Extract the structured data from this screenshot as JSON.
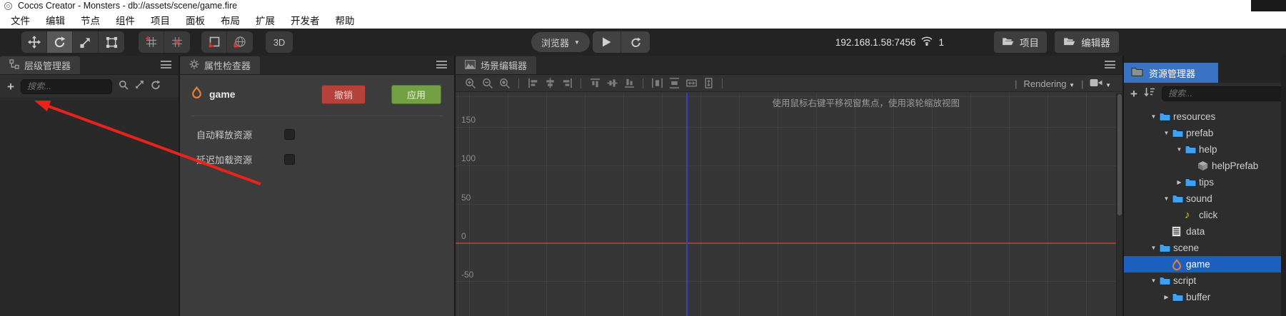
{
  "window": {
    "title": "Cocos Creator - Monsters - db://assets/scene/game.fire",
    "menus": [
      "文件",
      "编辑",
      "节点",
      "组件",
      "项目",
      "面板",
      "布局",
      "扩展",
      "开发者",
      "帮助"
    ]
  },
  "toolbar": {
    "transform_tools": [
      {
        "name": "move-tool",
        "icon": "move",
        "active": false
      },
      {
        "name": "rotate-tool",
        "icon": "rotate",
        "active": true
      },
      {
        "name": "scale-tool",
        "icon": "scale",
        "active": false
      },
      {
        "name": "rect-tool",
        "icon": "rect",
        "active": false
      }
    ],
    "gizmo_group_1": [
      {
        "name": "gizmo-position-button",
        "icon": "grid-red-corner"
      },
      {
        "name": "gizmo-anchor-button",
        "icon": "grid-red-center"
      }
    ],
    "gizmo_group_2": [
      {
        "name": "gizmo-local-button",
        "icon": "anchor-corner"
      },
      {
        "name": "gizmo-global-button",
        "icon": "anchor-globe"
      }
    ],
    "mode_label": "3D",
    "preview_target": "浏览器",
    "address": "192.168.1.58:7456",
    "device_count": "1",
    "project_button": "项目",
    "editor_button": "编辑器"
  },
  "hierarchy": {
    "title": "层级管理器",
    "search_placeholder": "搜索..."
  },
  "inspector": {
    "title": "属性检查器",
    "node_name": "game",
    "revert_button": "撤销",
    "apply_button": "应用",
    "properties": [
      {
        "label": "自动释放资源",
        "checked": false
      },
      {
        "label": "延迟加载资源",
        "checked": false
      }
    ]
  },
  "scene": {
    "title": "场景编辑器",
    "toolbar_icons": [
      "zoom-in-icon",
      "zoom-out-icon",
      "zoom-reset-icon",
      "sep",
      "align-left-edge-icon",
      "align-h-center-icon",
      "align-right-edge-icon",
      "sep",
      "align-top-edge-icon",
      "align-v-center-icon",
      "align-bottom-edge-icon",
      "sep",
      "distribute-h-icon",
      "distribute-v-icon",
      "stretch-h-icon",
      "stretch-v-icon",
      "sep"
    ],
    "rendering_label": "Rendering",
    "hint": "使用鼠标右键平移视窗焦点，使用滚轮缩放视图",
    "ruler_labels": [
      "150",
      "100",
      "50",
      "0",
      "-50"
    ]
  },
  "assets": {
    "title": "资源管理器",
    "search_placeholder": "搜索...",
    "tree": [
      {
        "label": "resources",
        "level": 0,
        "icon": "folder",
        "arrow": "open"
      },
      {
        "label": "prefab",
        "level": 1,
        "icon": "folder",
        "arrow": "open"
      },
      {
        "label": "help",
        "level": 2,
        "icon": "folder",
        "arrow": "open"
      },
      {
        "label": "helpPrefab",
        "level": 3,
        "icon": "prefab",
        "arrow": "none"
      },
      {
        "label": "tips",
        "level": 2,
        "icon": "folder",
        "arrow": "closed"
      },
      {
        "label": "sound",
        "level": 1,
        "icon": "folder",
        "arrow": "open"
      },
      {
        "label": "click",
        "level": 2,
        "icon": "audio",
        "arrow": "none"
      },
      {
        "label": "data",
        "level": 1,
        "icon": "file",
        "arrow": "none"
      },
      {
        "label": "scene",
        "level": 0,
        "icon": "folder",
        "arrow": "open"
      },
      {
        "label": "game",
        "level": 1,
        "icon": "fire",
        "arrow": "none",
        "selected": true
      },
      {
        "label": "script",
        "level": 0,
        "icon": "folder",
        "arrow": "open"
      },
      {
        "label": "buffer",
        "level": 1,
        "icon": "folder",
        "arrow": "closed"
      }
    ]
  },
  "colors": {
    "assets_tab_blue": "#3a72c4",
    "selection_blue": "#1c5fbe",
    "folder_blue": "#3da2f5",
    "revert_red": "#b5423a",
    "apply_green": "#73a043",
    "axis_red": "#a83c33",
    "canvas_blue": "#3d3dc9",
    "annotation_red": "#e8231a"
  }
}
